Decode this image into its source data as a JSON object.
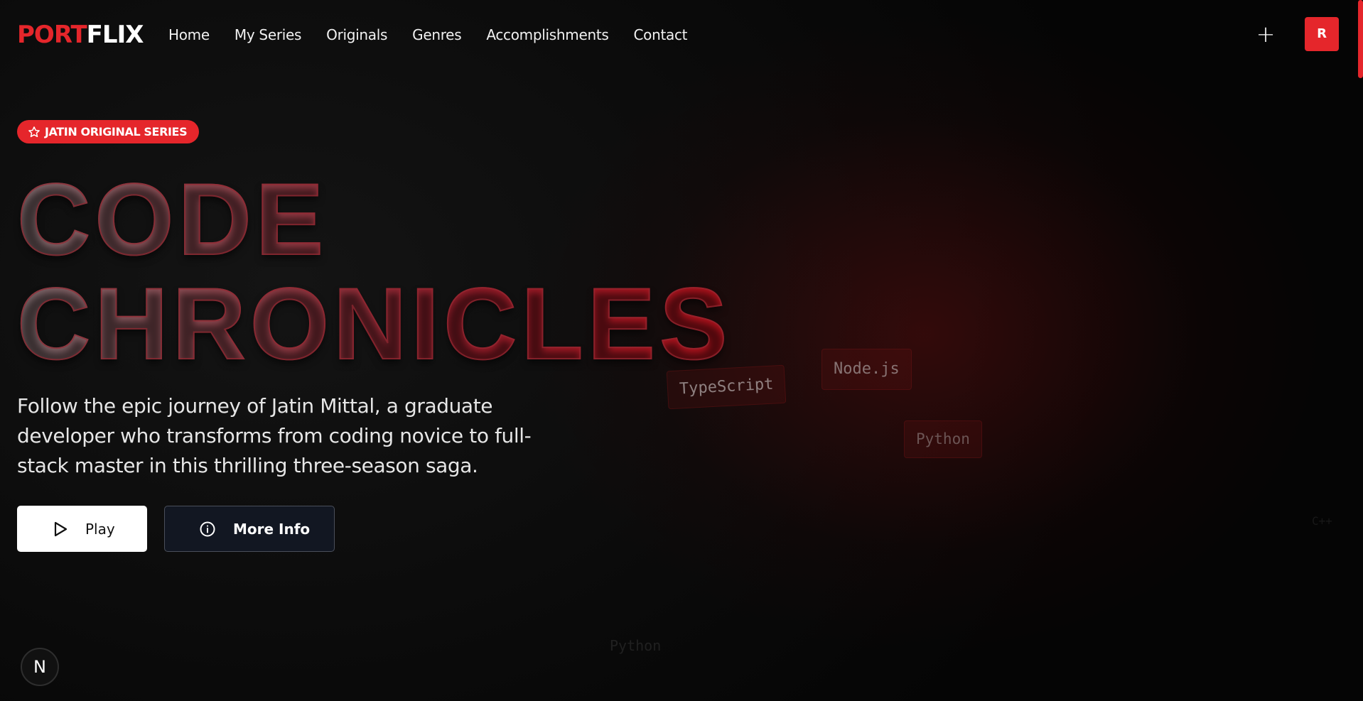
{
  "nav": {
    "logo_part1": "PORT",
    "logo_part2": "FLIX",
    "links": [
      "Home",
      "My Series",
      "Originals",
      "Genres",
      "Accomplishments",
      "Contact"
    ],
    "add_label": "+",
    "avatar_initial": "R"
  },
  "hero": {
    "badge": "JATIN ORIGINAL SERIES",
    "title_line1": "CODE",
    "title_line2": "CHRONICLES",
    "description": "Follow the epic journey of Jatin Mittal, a graduate developer who transforms from coding novice to full-stack master in this thrilling three-season saga.",
    "play_label": "Play",
    "info_label": "More Info"
  },
  "floating_tags": {
    "tag1": "TypeScript",
    "tag2": "Node.js",
    "tag3": "Python",
    "ghost1": "Python",
    "ghost2": "C++"
  },
  "dev_badge": "N",
  "colors": {
    "brand_red": "#e5262b",
    "info_button_bg": "#121722"
  },
  "icons": {
    "badge": "star-icon",
    "play": "play-icon",
    "info": "info-icon"
  }
}
